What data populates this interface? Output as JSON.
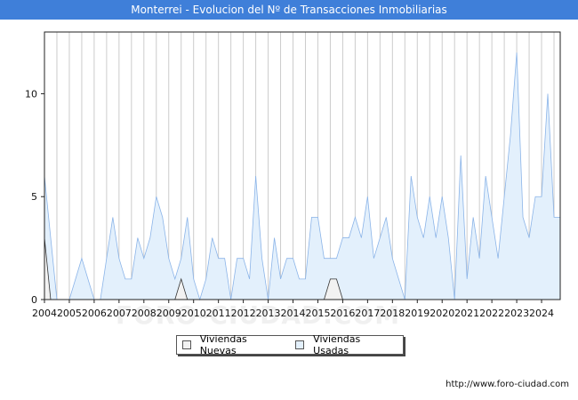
{
  "title": "Monterrei - Evolucion del Nº de Transacciones Inmobiliarias",
  "watermark": "FORO-CIUDAD.COM",
  "footer_url": "http://www.foro-ciudad.com",
  "colors": {
    "title_bg": "#3f7fd9",
    "usadas_fill": "#e3f0fc",
    "usadas_line": "#8bb4e8",
    "nuevas_fill": "#f2f2f2",
    "nuevas_line": "#333333",
    "grid": "#cccccc"
  },
  "chart_data": {
    "type": "area",
    "title": "Monterrei - Evolucion del Nº de Transacciones Inmobiliarias",
    "xlabel": "",
    "ylabel": "",
    "x_unit": "quarter",
    "x_start": "2004 Q1",
    "x_tick_labels": [
      "2004",
      "2005",
      "2006",
      "2007",
      "2008",
      "2009",
      "2010",
      "2011",
      "2012",
      "2013",
      "2014",
      "2015",
      "2016",
      "2017",
      "2018",
      "2019",
      "2020",
      "2021",
      "2022",
      "2023",
      "2024"
    ],
    "xlim": [
      2004,
      2024.75
    ],
    "ylim": [
      0,
      13
    ],
    "y_ticks": [
      0,
      5,
      10
    ],
    "grid": "vertical",
    "legend_placement": "bottom",
    "series": [
      {
        "name": "Viviendas Nuevas",
        "values": [
          3,
          0,
          0,
          0,
          0,
          0,
          0,
          0,
          0,
          0,
          0,
          0,
          0,
          0,
          0,
          0,
          0,
          0,
          0,
          0,
          0,
          0,
          1,
          0,
          0,
          0,
          0,
          0,
          0,
          0,
          0,
          0,
          0,
          0,
          0,
          0,
          0,
          0,
          0,
          0,
          0,
          0,
          0,
          0,
          0,
          0,
          1,
          1,
          0,
          0,
          0,
          0,
          0,
          0,
          0,
          0,
          0,
          0,
          0,
          0,
          0,
          0,
          0,
          0,
          0,
          0,
          0,
          0,
          0,
          0,
          0,
          0,
          0,
          0,
          0,
          0,
          0,
          0,
          0,
          0,
          0,
          0,
          0,
          0
        ]
      },
      {
        "name": "Viviendas Usadas",
        "values": [
          6,
          3,
          0,
          0,
          0,
          1,
          2,
          1,
          0,
          0,
          2,
          4,
          2,
          1,
          1,
          3,
          2,
          3,
          5,
          4,
          2,
          1,
          2,
          4,
          1,
          0,
          1,
          3,
          2,
          2,
          0,
          2,
          2,
          1,
          6,
          2,
          0,
          3,
          1,
          2,
          2,
          1,
          1,
          4,
          4,
          2,
          2,
          2,
          3,
          3,
          4,
          3,
          5,
          2,
          3,
          4,
          2,
          1,
          0,
          6,
          4,
          3,
          5,
          3,
          5,
          3,
          0,
          7,
          1,
          4,
          2,
          6,
          4,
          2,
          5,
          8,
          12,
          4,
          3,
          5,
          5,
          10,
          4,
          4
        ]
      }
    ]
  },
  "legend": {
    "items": [
      {
        "label": "Viviendas Nuevas",
        "color": "#f2f2f2"
      },
      {
        "label": "Viviendas Usadas",
        "color": "#e3f0fc"
      }
    ]
  }
}
